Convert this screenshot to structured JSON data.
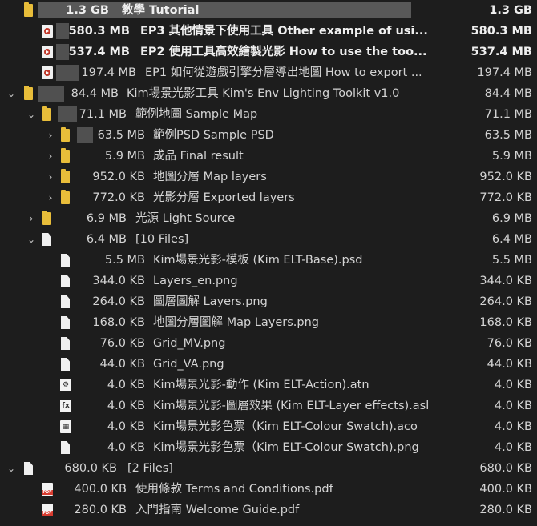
{
  "rows": [
    {
      "size": "1.3 GB",
      "name": "教學 Tutorial",
      "rsize": "1.3 GB"
    },
    {
      "size": "580.3 MB",
      "name": "EP3 其他情景下使用工具 Other example of usi...",
      "rsize": "580.3 MB"
    },
    {
      "size": "537.4 MB",
      "name": "EP2 使用工具高效繪製光影 How to use the too...",
      "rsize": "537.4 MB"
    },
    {
      "size": "197.4 MB",
      "name": "EP1 如何從遊戲引擎分層導出地圖 How to export ...",
      "rsize": "197.4 MB"
    },
    {
      "size": "84.4 MB",
      "name": "Kim場景光影工具 Kim's Env Lighting Toolkit v1.0",
      "rsize": "84.4 MB"
    },
    {
      "size": "71.1 MB",
      "name": "範例地圖 Sample Map",
      "rsize": "71.1 MB"
    },
    {
      "size": "63.5 MB",
      "name": "範例PSD Sample PSD",
      "rsize": "63.5 MB"
    },
    {
      "size": "5.9 MB",
      "name": "成品 Final result",
      "rsize": "5.9 MB"
    },
    {
      "size": "952.0 KB",
      "name": "地圖分層 Map layers",
      "rsize": "952.0 KB"
    },
    {
      "size": "772.0 KB",
      "name": "光影分層 Exported layers",
      "rsize": "772.0 KB"
    },
    {
      "size": "6.9 MB",
      "name": "光源 Light Source",
      "rsize": "6.9 MB"
    },
    {
      "size": "6.4 MB",
      "name": "[10 Files]",
      "rsize": "6.4 MB"
    },
    {
      "size": "5.5 MB",
      "name": "Kim場景光影-模板 (Kim ELT-Base).psd",
      "rsize": "5.5 MB"
    },
    {
      "size": "344.0 KB",
      "name": "Layers_en.png",
      "rsize": "344.0 KB"
    },
    {
      "size": "264.0 KB",
      "name": "圖層圖解 Layers.png",
      "rsize": "264.0 KB"
    },
    {
      "size": "168.0 KB",
      "name": "地圖分層圖解 Map Layers.png",
      "rsize": "168.0 KB"
    },
    {
      "size": "76.0 KB",
      "name": "Grid_MV.png",
      "rsize": "76.0 KB"
    },
    {
      "size": "44.0 KB",
      "name": "Grid_VA.png",
      "rsize": "44.0 KB"
    },
    {
      "size": "4.0 KB",
      "name": "Kim場景光影-動作 (Kim ELT-Action).atn",
      "rsize": "4.0 KB"
    },
    {
      "size": "4.0 KB",
      "name": "Kim場景光影-圖層效果 (Kim ELT-Layer effects).asl",
      "rsize": "4.0 KB"
    },
    {
      "size": "4.0 KB",
      "name": "Kim場景光影色票（Kim ELT-Colour Swatch).aco",
      "rsize": "4.0 KB"
    },
    {
      "size": "4.0 KB",
      "name": "Kim場景光影色票（Kim ELT-Colour Swatch).png",
      "rsize": "4.0 KB"
    },
    {
      "size": "680.0 KB",
      "name": "[2 Files]",
      "rsize": "680.0 KB"
    },
    {
      "size": "400.0 KB",
      "name": "使用條款 Terms and Conditions.pdf",
      "rsize": "400.0 KB"
    },
    {
      "size": "280.0 KB",
      "name": "入門指南 Welcome Guide.pdf",
      "rsize": "280.0 KB"
    }
  ],
  "app_icon_labels": {
    "atn": "⚙",
    "asl": "fx",
    "aco": "▦"
  },
  "colors": {
    "background": "#1d1d1d",
    "folder": "#e8bd3a",
    "text": "#d4d4d4",
    "pdf": "#d83b2f"
  }
}
